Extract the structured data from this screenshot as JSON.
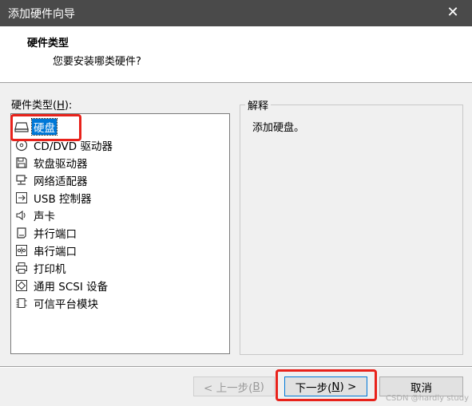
{
  "window": {
    "title": "添加硬件向导",
    "close_glyph": "✕"
  },
  "header": {
    "title": "硬件类型",
    "subtitle": "您要安装哪类硬件?"
  },
  "list": {
    "label_prefix": "硬件类型(",
    "label_key": "H",
    "label_suffix": "):",
    "items": [
      {
        "label": "硬盘",
        "icon": "hard-disk-icon",
        "selected": true
      },
      {
        "label": "CD/DVD 驱动器",
        "icon": "cd-dvd-icon"
      },
      {
        "label": "软盘驱动器",
        "icon": "floppy-icon"
      },
      {
        "label": "网络适配器",
        "icon": "network-adapter-icon"
      },
      {
        "label": "USB 控制器",
        "icon": "usb-icon"
      },
      {
        "label": "声卡",
        "icon": "speaker-icon"
      },
      {
        "label": "并行端口",
        "icon": "parallel-port-icon"
      },
      {
        "label": "串行端口",
        "icon": "serial-port-icon"
      },
      {
        "label": "打印机",
        "icon": "printer-icon"
      },
      {
        "label": "通用 SCSI 设备",
        "icon": "scsi-icon"
      },
      {
        "label": "可信平台模块",
        "icon": "tpm-icon"
      }
    ]
  },
  "explanation": {
    "legend": "解释",
    "text": "添加硬盘。"
  },
  "buttons": {
    "back": {
      "prefix": "< 上一步(",
      "key": "B",
      "suffix": ")"
    },
    "next": {
      "prefix": "下一步(",
      "key": "N",
      "suffix": ") >"
    },
    "cancel": {
      "label": "取消"
    }
  },
  "watermark": "CSDN @hardly study",
  "colors": {
    "titlebar": "#4a4a4a",
    "selection": "#0078d7",
    "highlight": "#e8221b"
  }
}
